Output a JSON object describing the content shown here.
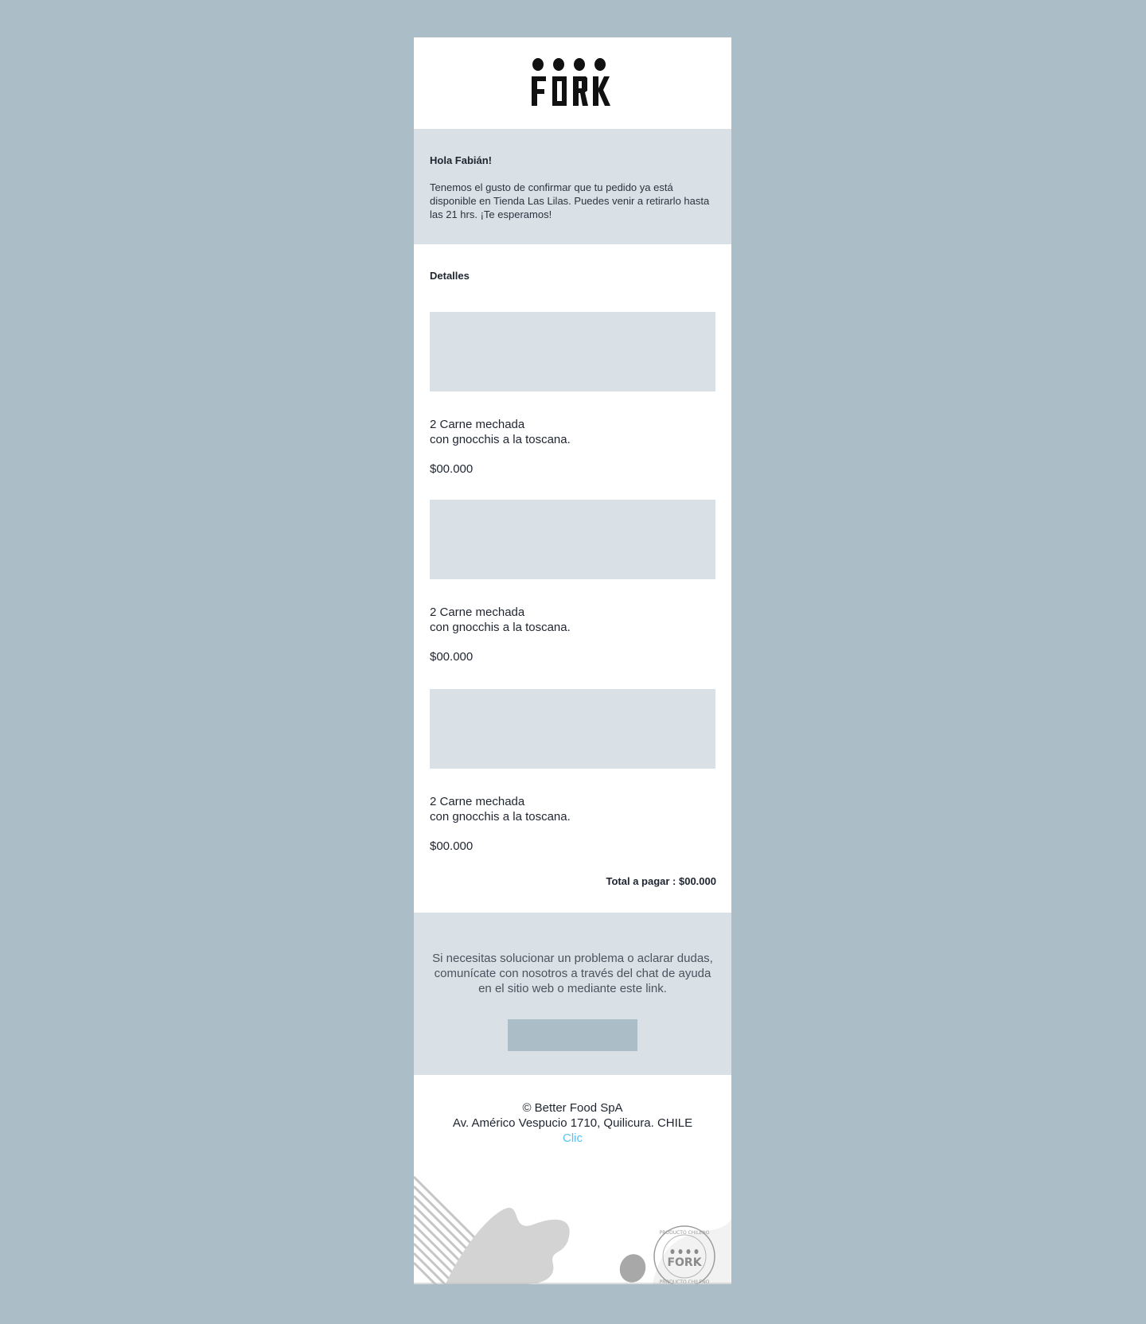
{
  "brand": {
    "logo_text": "FORK"
  },
  "greeting": {
    "hello": "Hola Fabián!",
    "message": "Tenemos el gusto de confirmar que tu pedido ya está disponible en Tienda Las Lilas. Puedes venir a retirarlo hasta las 21 hrs.  ¡Te esperamos!"
  },
  "details": {
    "title": "Detalles",
    "items": [
      {
        "name_line1": "2 Carne mechada",
        "name_line2": "con gnocchis a la toscana.",
        "price": "$00.000"
      },
      {
        "name_line1": "2 Carne mechada",
        "name_line2": "con gnocchis a la toscana.",
        "price": "$00.000"
      },
      {
        "name_line1": "2 Carne mechada",
        "name_line2": "con gnocchis a la toscana.",
        "price": "$00.000"
      }
    ],
    "total": "Total a pagar : $00.000"
  },
  "help": {
    "text": "Si necesitas solucionar un problema o aclarar dudas, comunícate con nosotros a través del chat de ayuda en el sitio web o mediante este link."
  },
  "footer": {
    "company": "© Better Food SpA",
    "address": "Av. Américo Vespucio 1710, Quilicura. CHILE",
    "link": "Clic",
    "stamp_text": "PRODUCTO CHILENO",
    "stamp_logo": "FORK"
  },
  "colors": {
    "page_bg": "#abbdc7",
    "panel_bg": "#d9e1e6",
    "card_bg": "#ffffff",
    "text": "#1f2530",
    "link": "#56c2ef"
  }
}
